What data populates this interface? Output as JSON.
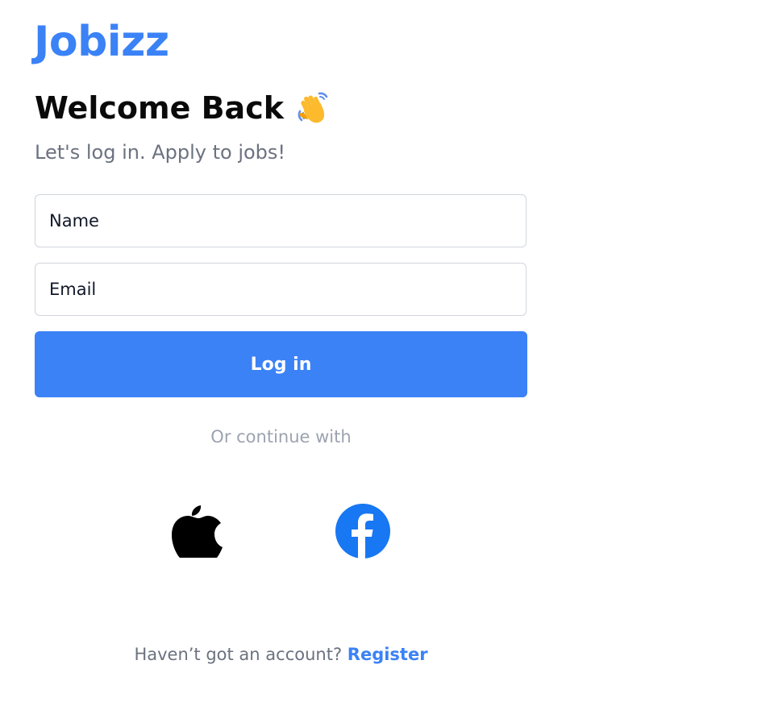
{
  "app": {
    "logo_text": "Jobizz"
  },
  "header": {
    "title": "Welcome Back",
    "title_emoji_icon": "waving-hand-icon",
    "subtitle": "Let's log in. Apply to jobs!"
  },
  "form": {
    "name_placeholder": "Name",
    "name_value": "",
    "email_placeholder": "Email",
    "email_value": "",
    "submit_label": "Log in"
  },
  "social": {
    "divider_text": "Or continue with",
    "providers": [
      {
        "name": "Apple",
        "icon": "apple-icon"
      },
      {
        "name": "Facebook",
        "icon": "facebook-icon"
      }
    ]
  },
  "footer": {
    "prompt_text": "Haven’t got an account?",
    "register_link": "Register"
  },
  "colors": {
    "brand": "#3B82F6",
    "facebook": "#1877F2",
    "text_dark": "#0a0a0a",
    "text_muted": "#6B7280",
    "text_light": "#9CA3AF",
    "border": "#D1D5DB"
  }
}
